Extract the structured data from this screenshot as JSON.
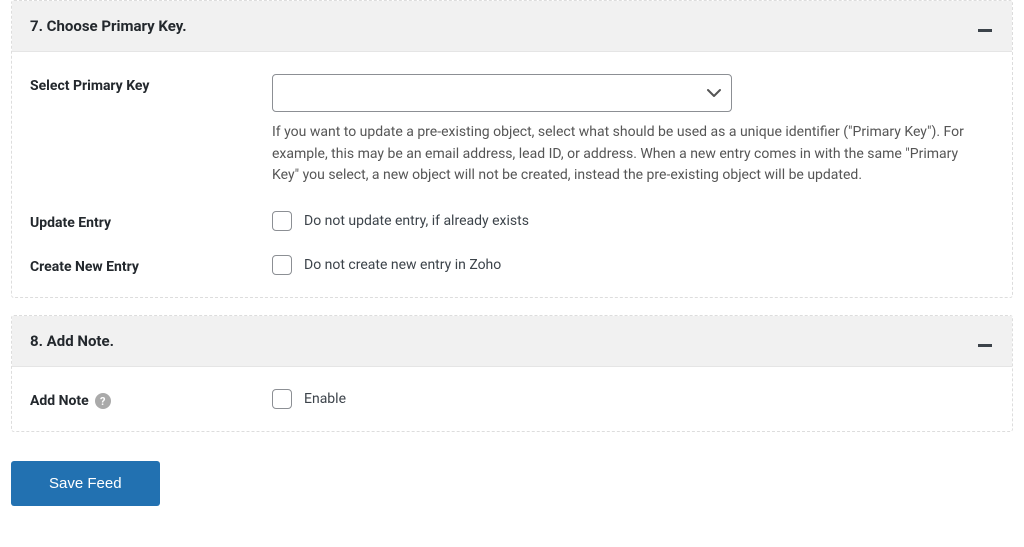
{
  "section7": {
    "title": "7. Choose Primary Key.",
    "primaryKey": {
      "label": "Select Primary Key",
      "help": "If you want to update a pre-existing object, select what should be used as a unique identifier (\"Primary Key\"). For example, this may be an email address, lead ID, or address. When a new entry comes in with the same \"Primary Key\" you select, a new object will not be created, instead the pre-existing object will be updated.",
      "value": ""
    },
    "updateEntry": {
      "label": "Update Entry",
      "checkboxLabel": "Do not update entry, if already exists"
    },
    "createNewEntry": {
      "label": "Create New Entry",
      "checkboxLabel": "Do not create new entry in Zoho"
    }
  },
  "section8": {
    "title": "8. Add Note.",
    "addNote": {
      "label": "Add Note",
      "checkboxLabel": "Enable"
    }
  },
  "actions": {
    "saveLabel": "Save Feed"
  }
}
